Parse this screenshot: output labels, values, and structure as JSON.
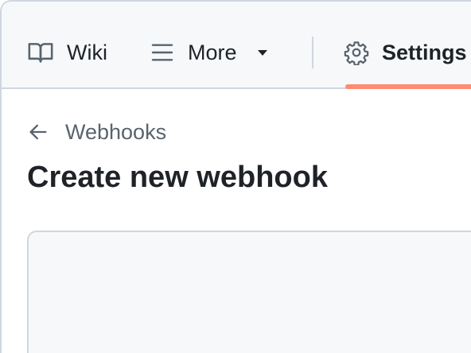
{
  "nav": {
    "wiki_label": "Wiki",
    "more_label": "More",
    "settings_label": "Settings",
    "icons": {
      "wiki": "book-icon",
      "more": "hamburger-menu-icon",
      "more_caret": "triangle-down-icon",
      "settings": "gear-icon"
    },
    "active_tab": "Settings",
    "active_underline_color": "#fd8c73"
  },
  "breadcrumb": {
    "back_label": "Webhooks",
    "icon": "arrow-left-icon"
  },
  "page": {
    "title": "Create new webhook"
  }
}
